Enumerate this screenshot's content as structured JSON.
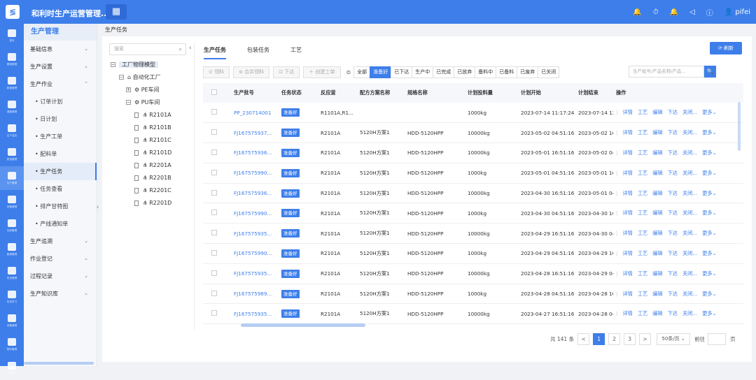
{
  "app": {
    "title": "和利时生产运营管理...",
    "logo": "≶",
    "grid_icon": "▦"
  },
  "topbar": {
    "icons": [
      "🔔",
      "⏱",
      "🔔",
      "◁",
      "ⓘ"
    ],
    "user": "pifei"
  },
  "rail": [
    {
      "label": "首页"
    },
    {
      "label": "基础数据"
    },
    {
      "label": "制造管理"
    },
    {
      "label": "调度管理"
    },
    {
      "label": "生产监控"
    },
    {
      "label": "质量管理"
    },
    {
      "label": "生产管理"
    },
    {
      "label": "设备管理"
    },
    {
      "label": "仓库管理"
    },
    {
      "label": "能源管理"
    },
    {
      "label": "安全管理"
    },
    {
      "label": "在线学习"
    },
    {
      "label": "设备管理"
    },
    {
      "label": "物料管理"
    },
    {
      "label": "系统"
    }
  ],
  "sidebar": {
    "title": "生产管理",
    "items": [
      {
        "label": "基础信息",
        "chev": "⌄"
      },
      {
        "label": "生产设置",
        "chev": "⌄"
      },
      {
        "label": "生产作业",
        "chev": "⌃"
      }
    ],
    "subitems": [
      "• 订单计划",
      "• 日计划",
      "• 生产工单",
      "• 配料单",
      "• 生产任务",
      "• 任务查看",
      "• 排产甘特图",
      "• 产线通知单"
    ],
    "items2": [
      {
        "label": "生产追溯",
        "chev": "⌄"
      },
      {
        "label": "作业登记",
        "chev": "⌄"
      },
      {
        "label": "过程记录",
        "chev": "⌄"
      },
      {
        "label": "生产知识库",
        "chev": "⌄"
      }
    ]
  },
  "breadcrumb": "生产任务",
  "tree": {
    "placeholder": "搜索",
    "nodes": [
      {
        "label": "工厂物理模型",
        "box": "−"
      },
      {
        "label": "自动化工厂",
        "box": "−"
      },
      {
        "label": "PE车间",
        "box": "+"
      },
      {
        "label": "PU车间",
        "box": "−"
      },
      {
        "label": "R2101A"
      },
      {
        "label": "R2101B"
      },
      {
        "label": "R2101C"
      },
      {
        "label": "R2101D"
      },
      {
        "label": "R2201A"
      },
      {
        "label": "R2201B"
      },
      {
        "label": "R2201C"
      },
      {
        "label": "R2201D"
      }
    ]
  },
  "tabs": [
    "生产任务",
    "包装任务",
    "工艺"
  ],
  "refresh": "⟳ 刷新",
  "toolbar": [
    "⊙ 领料",
    "⊜ 合并领料",
    "⊡ 下达",
    "＋ 创建工单"
  ],
  "filter_icon": "⊜",
  "filters": [
    "全部",
    "准备好",
    "已下达",
    "生产中",
    "已完成",
    "已放弃",
    "备料中",
    "已备料",
    "已废弃",
    "已关闭"
  ],
  "search_placeholder": "生产批号/产品名称/产品...",
  "search_icon": "🔍",
  "columns": [
    "",
    "生产批号",
    "任务状态",
    "反应釜",
    "配方方案名称",
    "规格名称",
    "计划投料量",
    "计划开始",
    "计划结束",
    "操作"
  ],
  "rows": [
    [
      "PP_230714001",
      "准备好",
      "R1101A,R1...",
      "",
      "",
      "1000kg",
      "2023-07-14 11:17:24",
      "2023-07-14 12"
    ],
    [
      "FJ167575937...",
      "准备好",
      "R2101A",
      "5120H方案1",
      "HDD-5120HPP",
      "10000kg",
      "2023-05-02 04:51:16",
      "2023-05-02 16"
    ],
    [
      "FJ167575936...",
      "准备好",
      "R2101A",
      "5120H方案1",
      "HDD-5120HPP",
      "10000kg",
      "2023-05-01 16:51:16",
      "2023-05-02 04"
    ],
    [
      "FJ167575990...",
      "准备好",
      "R2101A",
      "5120H方案1",
      "HDD-5120HPP",
      "1000kg",
      "2023-05-01 04:51:16",
      "2023-05-01 16"
    ],
    [
      "FJ167575936...",
      "准备好",
      "R2101A",
      "5120H方案1",
      "HDD-5120HPP",
      "10000kg",
      "2023-04-30 16:51:16",
      "2023-05-01 04"
    ],
    [
      "FJ167575990...",
      "准备好",
      "R2101A",
      "5120H方案1",
      "HDD-5120HPP",
      "1000kg",
      "2023-04-30 04:51:16",
      "2023-04-30 16"
    ],
    [
      "FJ167575935...",
      "准备好",
      "R2101A",
      "5120H方案1",
      "HDD-5120HPP",
      "10000kg",
      "2023-04-29 16:51:16",
      "2023-04-30 04"
    ],
    [
      "FJ167575990...",
      "准备好",
      "R2101A",
      "5120H方案1",
      "HDD-5120HPP",
      "1000kg",
      "2023-04-29 04:51:16",
      "2023-04-29 16"
    ],
    [
      "FJ167575935...",
      "准备好",
      "R2101A",
      "5120H方案1",
      "HDD-5120HPP",
      "10000kg",
      "2023-04-28 16:51:16",
      "2023-04-29 04"
    ],
    [
      "FJ167575989...",
      "准备好",
      "R2101A",
      "5120H方案1",
      "HDD-5120HPP",
      "1000kg",
      "2023-04-28 04:51:16",
      "2023-04-28 16"
    ],
    [
      "FJ167575935...",
      "准备好",
      "R2101A",
      "5120H方案1",
      "HDD-5120HPP",
      "10000kg",
      "2023-04-27 16:51:16",
      "2023-04-28 04"
    ]
  ],
  "row_ops": [
    "详情",
    "工艺",
    "编辑",
    "下达",
    "关闭...",
    "更多⌄"
  ],
  "pager": {
    "total": "共 141 条",
    "prev": "<",
    "pages": [
      "1",
      "2",
      "3"
    ],
    "next": ">",
    "size": "50条/页 ⌄",
    "goto": "前往",
    "unit": "页"
  }
}
